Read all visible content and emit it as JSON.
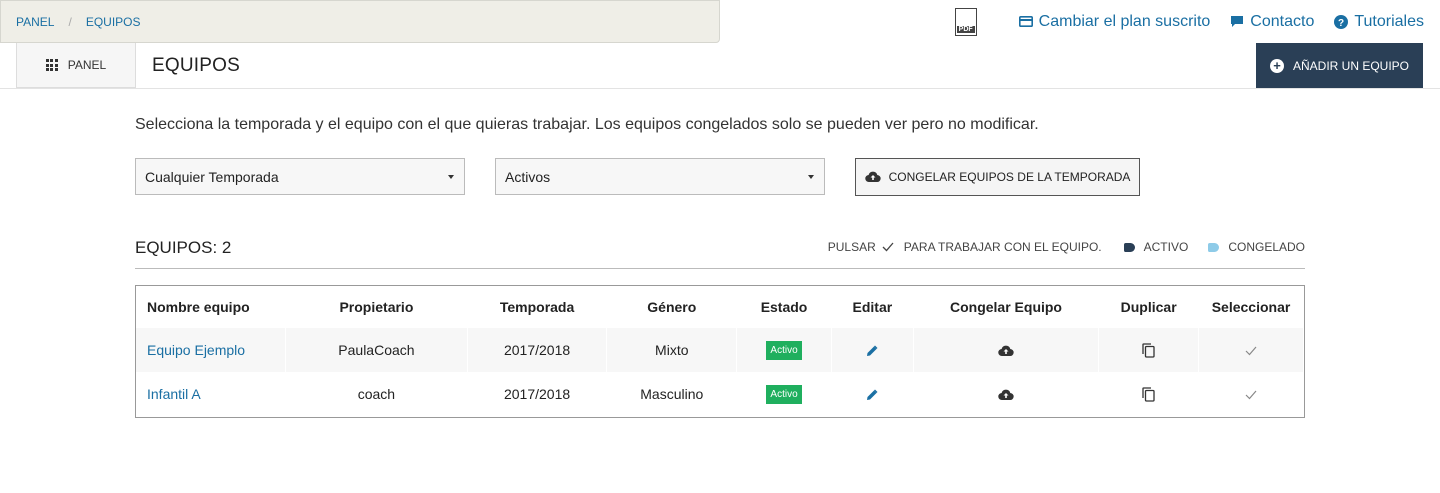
{
  "breadcrumb": {
    "items": [
      "PANEL",
      "EQUIPOS"
    ],
    "separator": "/"
  },
  "toplinks": {
    "pdf_icon_text": "PDF",
    "plan": "Cambiar el plan suscrito",
    "contact": "Contacto",
    "tutorials": "Tutoriales"
  },
  "subbar": {
    "panel_button": "PANEL",
    "title": "EQUIPOS",
    "add_button": "AÑADIR UN EQUIPO"
  },
  "main": {
    "intro": "Selecciona la temporada y el equipo con el que quieras trabajar. Los equipos congelados solo se pueden ver pero no modificar.",
    "season_select": {
      "value": "Cualquier Temporada"
    },
    "status_select": {
      "value": "Activos"
    },
    "freeze_button": "CONGELAR EQUIPOS DE LA TEMPORADA",
    "teams_count": "EQUIPOS: 2",
    "legend": {
      "pulsar": "PULSAR",
      "work": "PARA TRABAJAR CON EL EQUIPO.",
      "active": "ACTIVO",
      "frozen": "CONGELADO"
    }
  },
  "table": {
    "headers": [
      "Nombre equipo",
      "Propietario",
      "Temporada",
      "Género",
      "Estado",
      "Editar",
      "Congelar Equipo",
      "Duplicar",
      "Seleccionar"
    ],
    "rows": [
      {
        "name": "Equipo Ejemplo",
        "owner": "PaulaCoach",
        "season": "2017/2018",
        "gender": "Mixto",
        "status": "Activo"
      },
      {
        "name": "Infantil A",
        "owner": "coach",
        "season": "2017/2018",
        "gender": "Masculino",
        "status": "Activo"
      }
    ]
  },
  "colors": {
    "link": "#1a6fa3",
    "dark_button": "#2a3f56",
    "active_badge": "#1faf5e",
    "active_tag": "#2a3f56",
    "frozen_tag": "#8ecbe8",
    "breadcrumb_bg": "#efeee7"
  },
  "icons": {
    "panel": "grid-icon",
    "plan": "credit-card-icon",
    "contact": "chat-icon",
    "tutorials": "question-circle-icon",
    "add": "plus-circle-icon",
    "freeze": "cloud-upload-icon",
    "edit": "pencil-icon",
    "duplicate": "copy-icon",
    "select": "check-icon"
  }
}
